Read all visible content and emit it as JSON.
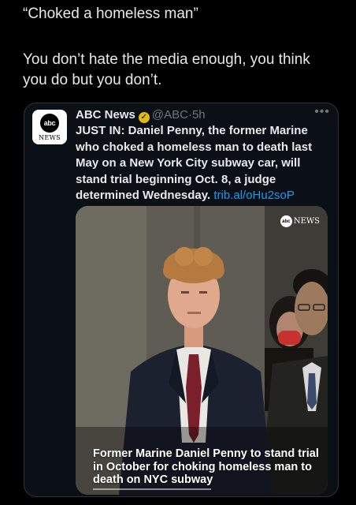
{
  "quote_tweet": {
    "quote_text": "“Choked a homeless man”",
    "comment_text": "You don’t hate the media enough, you think you do but you don’t."
  },
  "embedded_tweet": {
    "avatar": {
      "logo_text": "abc",
      "subtext": "NEWS"
    },
    "author_name": "ABC News",
    "verified_icon": "verified-badge-gold",
    "handle": "@ABC",
    "separator": "·",
    "time": "5h",
    "more_icon": "•••",
    "text": "JUST IN: Daniel Penny, the former Marine who choked a homeless man to death last May on a New York City subway car, will stand trial beginning Oct. 8, a judge determined Wednesday.",
    "link_text": "trib.al/oHu2soP",
    "media": {
      "logo_text": "abc",
      "logo_word": "NEWS",
      "caption": "Former Marine Daniel Penny to stand trial in October for choking homeless man to death on NYC subway"
    }
  },
  "colors": {
    "background": "#000000",
    "text": "#e7e9ea",
    "muted": "#71767b",
    "link": "#1d9bf0",
    "verified": "#e2b719",
    "card_border": "#2f3336"
  }
}
